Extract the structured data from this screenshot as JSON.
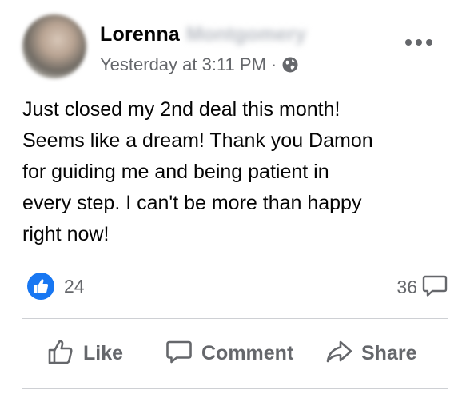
{
  "author": {
    "first_name": "Lorenna",
    "last_name_blurred": "Montgomery"
  },
  "meta": {
    "timestamp": "Yesterday at 3:11 PM",
    "separator": "·",
    "audience_icon": "globe-icon"
  },
  "post": {
    "text": "Just closed my 2nd deal this month!\nSeems like a dream! Thank you Damon\nfor guiding me and being patient in\nevery step. I can't be more than happy\nright now!"
  },
  "stats": {
    "reaction_icon": "like-reaction-icon",
    "reaction_count": "24",
    "comment_count": "36",
    "comment_icon": "comment-bubble-icon"
  },
  "actions": {
    "like_label": "Like",
    "comment_label": "Comment",
    "share_label": "Share"
  },
  "colors": {
    "text_primary": "#050505",
    "text_secondary": "#65676b",
    "like_blue": "#1877f2",
    "divider": "#ced0d4"
  }
}
